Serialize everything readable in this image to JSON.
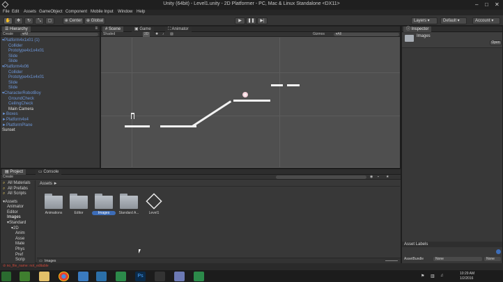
{
  "window": {
    "title": "Unity (64bit) - Level1.unity - 2D Platformer - PC, Mac & Linux Standalone <DX11>",
    "controls": [
      "–",
      "□",
      "✕"
    ]
  },
  "menubar": [
    "File",
    "Edit",
    "Assets",
    "GameObject",
    "Component",
    "Mobile Input",
    "Window",
    "Help"
  ],
  "toolbar": {
    "pivot": "Center",
    "space": "Global",
    "layers": "Layers",
    "layout": "Default",
    "account": "Account"
  },
  "hierarchy": {
    "tab": "Hierarchy",
    "create": "Create",
    "search_prefix": "▾All",
    "items": [
      {
        "label": "▾Platform4x1x01 (1)",
        "indent": 0,
        "color": "blue"
      },
      {
        "label": "Collider",
        "indent": 1,
        "color": "blue"
      },
      {
        "label": "Prototype4x1x4x01",
        "indent": 1,
        "color": "blue"
      },
      {
        "label": "Slide",
        "indent": 1,
        "color": "blue"
      },
      {
        "label": "Slide",
        "indent": 1,
        "color": "blue"
      },
      {
        "label": "▾Platform4x06",
        "indent": 0,
        "color": "blue"
      },
      {
        "label": "Collider",
        "indent": 1,
        "color": "blue"
      },
      {
        "label": "Prototype4x1x4x01",
        "indent": 1,
        "color": "blue"
      },
      {
        "label": "Slide",
        "indent": 1,
        "color": "blue"
      },
      {
        "label": "Slide",
        "indent": 1,
        "color": "blue"
      },
      {
        "label": "▾CharacterRobotBoy",
        "indent": 0,
        "color": "blue"
      },
      {
        "label": "GroundCheck",
        "indent": 1,
        "color": "blue"
      },
      {
        "label": "CeilingCheck",
        "indent": 1,
        "color": "blue"
      },
      {
        "label": "Main Camera",
        "indent": 1,
        "color": "white"
      },
      {
        "label": "►Boxes",
        "indent": 0,
        "color": "blue"
      },
      {
        "label": "►Platform4x4",
        "indent": 0,
        "color": "blue"
      },
      {
        "label": "►PlatformPlane",
        "indent": 0,
        "color": "blue"
      },
      {
        "label": "Sunset",
        "indent": 0,
        "color": "white"
      }
    ]
  },
  "scene": {
    "tabs": [
      "Scene",
      "Game",
      "Animator"
    ],
    "shading": "Shaded",
    "mode_2d": "2D",
    "gizmos": "Gizmos",
    "search_prefix": "▾All"
  },
  "inspector": {
    "tab": "Inspector",
    "object_name": "Images",
    "open_button": "Open",
    "asset_labels_title": "Asset Labels",
    "assetbundle_label": "AssetBundle",
    "assetbundle_value": "None",
    "variant_value": "None"
  },
  "project": {
    "tabs": [
      "Project",
      "Console"
    ],
    "create": "Create",
    "favorites": [
      "All Materials",
      "All Prefabs",
      "All Scripts"
    ],
    "tree": [
      {
        "label": "▾Assets",
        "indent": 0
      },
      {
        "label": "Animator",
        "indent": 1
      },
      {
        "label": "Editor",
        "indent": 1
      },
      {
        "label": "Images",
        "indent": 1
      },
      {
        "label": "▾Standard",
        "indent": 1
      },
      {
        "label": "▾2D",
        "indent": 2
      },
      {
        "label": "Anim",
        "indent": 3
      },
      {
        "label": "Asse",
        "indent": 3
      },
      {
        "label": "Mate",
        "indent": 3
      },
      {
        "label": "Phys",
        "indent": 3
      },
      {
        "label": "Pref",
        "indent": 3
      },
      {
        "label": "Scrip",
        "indent": 3
      }
    ],
    "breadcrumb": "Assets ►",
    "assets": [
      {
        "label": "Animations",
        "kind": "folder",
        "selected": false
      },
      {
        "label": "Editor",
        "kind": "folder",
        "selected": false
      },
      {
        "label": "Images",
        "kind": "folder",
        "selected": true
      },
      {
        "label": "Standard A...",
        "kind": "folder",
        "selected": false
      },
      {
        "label": "Level1",
        "kind": "unity-scene",
        "selected": false
      }
    ],
    "footer_path": "Images"
  },
  "statusbar": {
    "message": "⊘ no_file_name: not_editable"
  },
  "taskbar": {
    "apps": [
      "explorer",
      "chrome",
      "network",
      "camtasia",
      "photoshop",
      "unity",
      "vs",
      "camtasia-recorder"
    ],
    "time": "10:29 AM",
    "date": "1/2/2016"
  },
  "colors": {
    "hierarchy_blue": "#6d96d8",
    "scene_bg": "#4f4f4f",
    "selection_blue": "#3d6db8"
  }
}
